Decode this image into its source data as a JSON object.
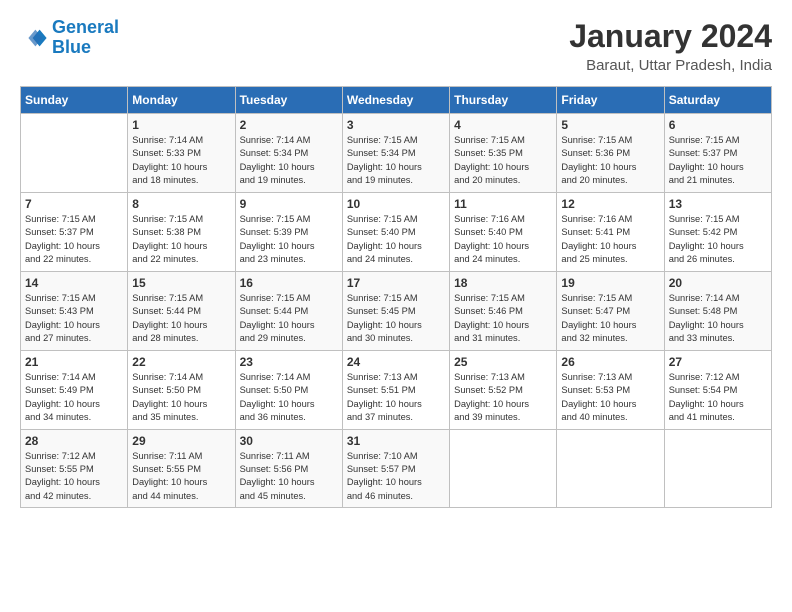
{
  "logo": {
    "text_general": "General",
    "text_blue": "Blue"
  },
  "title": "January 2024",
  "subtitle": "Baraut, Uttar Pradesh, India",
  "header_days": [
    "Sunday",
    "Monday",
    "Tuesday",
    "Wednesday",
    "Thursday",
    "Friday",
    "Saturday"
  ],
  "weeks": [
    [
      {
        "num": "",
        "lines": []
      },
      {
        "num": "1",
        "lines": [
          "Sunrise: 7:14 AM",
          "Sunset: 5:33 PM",
          "Daylight: 10 hours",
          "and 18 minutes."
        ]
      },
      {
        "num": "2",
        "lines": [
          "Sunrise: 7:14 AM",
          "Sunset: 5:34 PM",
          "Daylight: 10 hours",
          "and 19 minutes."
        ]
      },
      {
        "num": "3",
        "lines": [
          "Sunrise: 7:15 AM",
          "Sunset: 5:34 PM",
          "Daylight: 10 hours",
          "and 19 minutes."
        ]
      },
      {
        "num": "4",
        "lines": [
          "Sunrise: 7:15 AM",
          "Sunset: 5:35 PM",
          "Daylight: 10 hours",
          "and 20 minutes."
        ]
      },
      {
        "num": "5",
        "lines": [
          "Sunrise: 7:15 AM",
          "Sunset: 5:36 PM",
          "Daylight: 10 hours",
          "and 20 minutes."
        ]
      },
      {
        "num": "6",
        "lines": [
          "Sunrise: 7:15 AM",
          "Sunset: 5:37 PM",
          "Daylight: 10 hours",
          "and 21 minutes."
        ]
      }
    ],
    [
      {
        "num": "7",
        "lines": [
          "Sunrise: 7:15 AM",
          "Sunset: 5:37 PM",
          "Daylight: 10 hours",
          "and 22 minutes."
        ]
      },
      {
        "num": "8",
        "lines": [
          "Sunrise: 7:15 AM",
          "Sunset: 5:38 PM",
          "Daylight: 10 hours",
          "and 22 minutes."
        ]
      },
      {
        "num": "9",
        "lines": [
          "Sunrise: 7:15 AM",
          "Sunset: 5:39 PM",
          "Daylight: 10 hours",
          "and 23 minutes."
        ]
      },
      {
        "num": "10",
        "lines": [
          "Sunrise: 7:15 AM",
          "Sunset: 5:40 PM",
          "Daylight: 10 hours",
          "and 24 minutes."
        ]
      },
      {
        "num": "11",
        "lines": [
          "Sunrise: 7:16 AM",
          "Sunset: 5:40 PM",
          "Daylight: 10 hours",
          "and 24 minutes."
        ]
      },
      {
        "num": "12",
        "lines": [
          "Sunrise: 7:16 AM",
          "Sunset: 5:41 PM",
          "Daylight: 10 hours",
          "and 25 minutes."
        ]
      },
      {
        "num": "13",
        "lines": [
          "Sunrise: 7:15 AM",
          "Sunset: 5:42 PM",
          "Daylight: 10 hours",
          "and 26 minutes."
        ]
      }
    ],
    [
      {
        "num": "14",
        "lines": [
          "Sunrise: 7:15 AM",
          "Sunset: 5:43 PM",
          "Daylight: 10 hours",
          "and 27 minutes."
        ]
      },
      {
        "num": "15",
        "lines": [
          "Sunrise: 7:15 AM",
          "Sunset: 5:44 PM",
          "Daylight: 10 hours",
          "and 28 minutes."
        ]
      },
      {
        "num": "16",
        "lines": [
          "Sunrise: 7:15 AM",
          "Sunset: 5:44 PM",
          "Daylight: 10 hours",
          "and 29 minutes."
        ]
      },
      {
        "num": "17",
        "lines": [
          "Sunrise: 7:15 AM",
          "Sunset: 5:45 PM",
          "Daylight: 10 hours",
          "and 30 minutes."
        ]
      },
      {
        "num": "18",
        "lines": [
          "Sunrise: 7:15 AM",
          "Sunset: 5:46 PM",
          "Daylight: 10 hours",
          "and 31 minutes."
        ]
      },
      {
        "num": "19",
        "lines": [
          "Sunrise: 7:15 AM",
          "Sunset: 5:47 PM",
          "Daylight: 10 hours",
          "and 32 minutes."
        ]
      },
      {
        "num": "20",
        "lines": [
          "Sunrise: 7:14 AM",
          "Sunset: 5:48 PM",
          "Daylight: 10 hours",
          "and 33 minutes."
        ]
      }
    ],
    [
      {
        "num": "21",
        "lines": [
          "Sunrise: 7:14 AM",
          "Sunset: 5:49 PM",
          "Daylight: 10 hours",
          "and 34 minutes."
        ]
      },
      {
        "num": "22",
        "lines": [
          "Sunrise: 7:14 AM",
          "Sunset: 5:50 PM",
          "Daylight: 10 hours",
          "and 35 minutes."
        ]
      },
      {
        "num": "23",
        "lines": [
          "Sunrise: 7:14 AM",
          "Sunset: 5:50 PM",
          "Daylight: 10 hours",
          "and 36 minutes."
        ]
      },
      {
        "num": "24",
        "lines": [
          "Sunrise: 7:13 AM",
          "Sunset: 5:51 PM",
          "Daylight: 10 hours",
          "and 37 minutes."
        ]
      },
      {
        "num": "25",
        "lines": [
          "Sunrise: 7:13 AM",
          "Sunset: 5:52 PM",
          "Daylight: 10 hours",
          "and 39 minutes."
        ]
      },
      {
        "num": "26",
        "lines": [
          "Sunrise: 7:13 AM",
          "Sunset: 5:53 PM",
          "Daylight: 10 hours",
          "and 40 minutes."
        ]
      },
      {
        "num": "27",
        "lines": [
          "Sunrise: 7:12 AM",
          "Sunset: 5:54 PM",
          "Daylight: 10 hours",
          "and 41 minutes."
        ]
      }
    ],
    [
      {
        "num": "28",
        "lines": [
          "Sunrise: 7:12 AM",
          "Sunset: 5:55 PM",
          "Daylight: 10 hours",
          "and 42 minutes."
        ]
      },
      {
        "num": "29",
        "lines": [
          "Sunrise: 7:11 AM",
          "Sunset: 5:55 PM",
          "Daylight: 10 hours",
          "and 44 minutes."
        ]
      },
      {
        "num": "30",
        "lines": [
          "Sunrise: 7:11 AM",
          "Sunset: 5:56 PM",
          "Daylight: 10 hours",
          "and 45 minutes."
        ]
      },
      {
        "num": "31",
        "lines": [
          "Sunrise: 7:10 AM",
          "Sunset: 5:57 PM",
          "Daylight: 10 hours",
          "and 46 minutes."
        ]
      },
      {
        "num": "",
        "lines": []
      },
      {
        "num": "",
        "lines": []
      },
      {
        "num": "",
        "lines": []
      }
    ]
  ]
}
